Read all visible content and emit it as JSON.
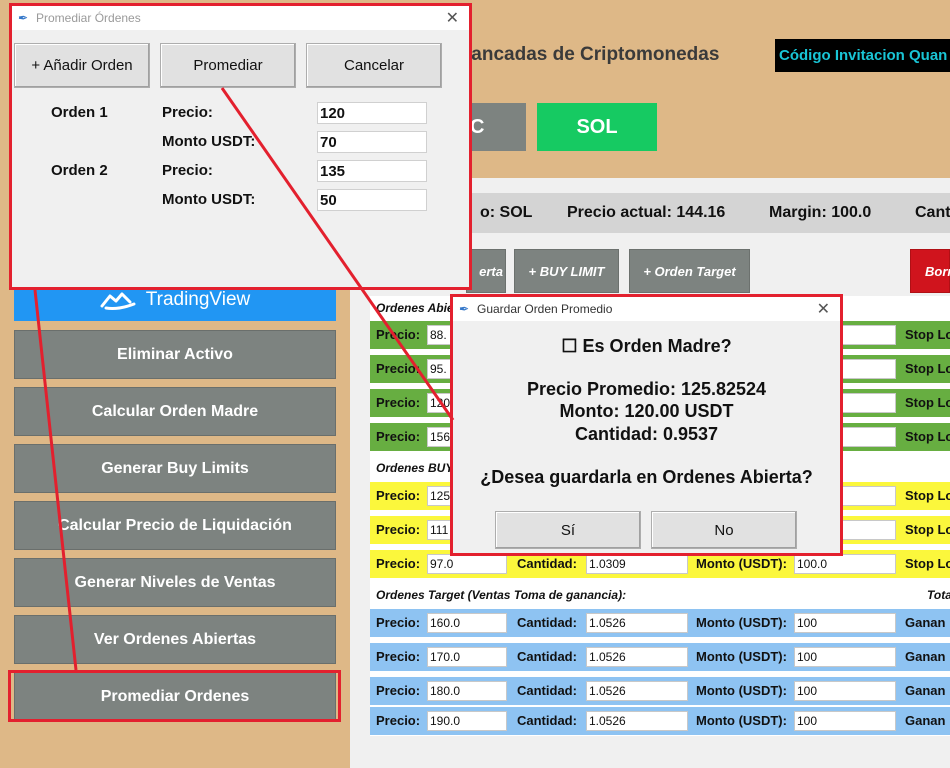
{
  "main": {
    "title": "lancadas de Criptomonedas",
    "invite": "Código Invitacion Quan",
    "coin_prev": "C",
    "coin_sol": "SOL",
    "info": {
      "activo": "o: SOL",
      "precio": "Precio actual: 144.16",
      "margin": "Margin: 100.0",
      "cant": "Cant"
    },
    "toolbar": {
      "alerta": "erta",
      "buy_limit": "+ BUY LIMIT",
      "orden_target": "+ Orden Target",
      "borrar": "Borr"
    }
  },
  "sidebar": {
    "tradingview": "TradingView",
    "buttons": [
      "Eliminar Activo",
      "Calcular Orden Madre",
      "Generar Buy Limits",
      "Calcular Precio de Liquidación",
      "Generar Niveles de Ventas",
      "Ver Ordenes Abiertas",
      "Promediar Ordenes"
    ]
  },
  "orders": {
    "abiertas_title": "Ordenes Abie",
    "abiertas_rows": [
      {
        "precio": "88.",
        "right": "Stop Lo"
      },
      {
        "precio": "95.",
        "right": "Stop Lo"
      },
      {
        "precio": "120",
        "right": "Stop Lo"
      },
      {
        "precio": "156",
        "right": "Stop Lo"
      }
    ],
    "buy_title": "Ordenes BUY",
    "buy_rows": [
      {
        "precio": "125",
        "right": "Stop Lo"
      },
      {
        "precio": "111",
        "right": "Stop Lo"
      },
      {
        "precio": "97.0",
        "cantidad": "1.0309",
        "monto": "100.0",
        "right": "Stop Lo"
      }
    ],
    "target_title": "Ordenes Target (Ventas Toma de ganancia):",
    "target_total": "Tota",
    "target_rows": [
      {
        "precio": "160.0",
        "cantidad": "1.0526",
        "monto": "100",
        "right": "Ganan"
      },
      {
        "precio": "170.0",
        "cantidad": "1.0526",
        "monto": "100",
        "right": "Ganan"
      },
      {
        "precio": "180.0",
        "cantidad": "1.0526",
        "monto": "100",
        "right": "Ganan"
      },
      {
        "precio": "190.0",
        "cantidad": "1.0526",
        "monto": "100",
        "right": "Ganan"
      }
    ],
    "labels": {
      "precio": "Precio:",
      "cantidad": "Cantidad:",
      "monto": "Monto (USDT):"
    }
  },
  "dialog_promediar": {
    "title": "Promediar Órdenes",
    "close": "✕",
    "btn_add": "+ Añadir Orden",
    "btn_promediar": "Promediar",
    "btn_cancelar": "Cancelar",
    "orden1_label": "Orden 1",
    "orden2_label": "Orden 2",
    "precio_label": "Precio:",
    "monto_label": "Monto USDT:",
    "orden1_precio": "120",
    "orden1_monto": "70",
    "orden2_precio": "135",
    "orden2_monto": "50"
  },
  "dialog_guardar": {
    "title": "Guardar Orden Promedio",
    "close": "✕",
    "checkbox_label": "☐ Es Orden Madre?",
    "precio_promedio": "Precio Promedio: 125.82524",
    "monto": "Monto: 120.00 USDT",
    "cantidad": "Cantidad: 0.9537",
    "question": "¿Desea guardarla en Ordenes Abierta?",
    "btn_si": "Sí",
    "btn_no": "No"
  },
  "colors": {
    "highlight": "#e3202e",
    "sidebar_bg": "#deb887",
    "button_gray": "#7d8380",
    "sol_green": "#16ca62",
    "tradingview_blue": "#2196f3"
  }
}
